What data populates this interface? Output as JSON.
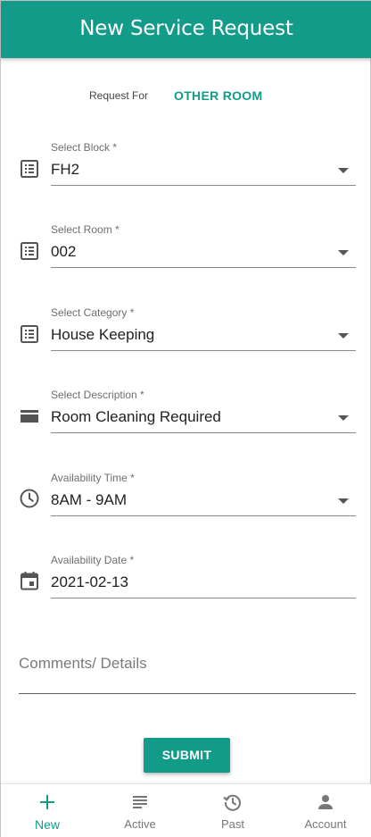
{
  "header": {
    "title": "New Service Request"
  },
  "request_for": {
    "label": "Request For",
    "value": "OTHER ROOM"
  },
  "fields": [
    {
      "label": "Select Block *",
      "value": "FH2",
      "icon": "list-icon"
    },
    {
      "label": "Select Room *",
      "value": "002",
      "icon": "list-icon"
    },
    {
      "label": "Select Category *",
      "value": "House Keeping",
      "icon": "list-icon"
    },
    {
      "label": "Select Description *",
      "value": "Room Cleaning Required",
      "icon": "subtitles-icon"
    },
    {
      "label": "Availability Time *",
      "value": "8AM - 9AM",
      "icon": "clock-icon"
    },
    {
      "label": "Availability Date *",
      "value": "2021-02-13",
      "icon": "calendar-icon"
    }
  ],
  "comments": {
    "placeholder": "Comments/ Details"
  },
  "submit_label": "SUBMIT",
  "bottom_nav": [
    {
      "label": "New",
      "icon": "plus-icon",
      "active": true
    },
    {
      "label": "Active",
      "icon": "list-lines-icon",
      "active": false
    },
    {
      "label": "Past",
      "icon": "history-icon",
      "active": false
    },
    {
      "label": "Account",
      "icon": "person-icon",
      "active": false
    }
  ],
  "colors": {
    "primary": "#129b89",
    "text": "#212121",
    "muted": "#6e6e6e"
  }
}
